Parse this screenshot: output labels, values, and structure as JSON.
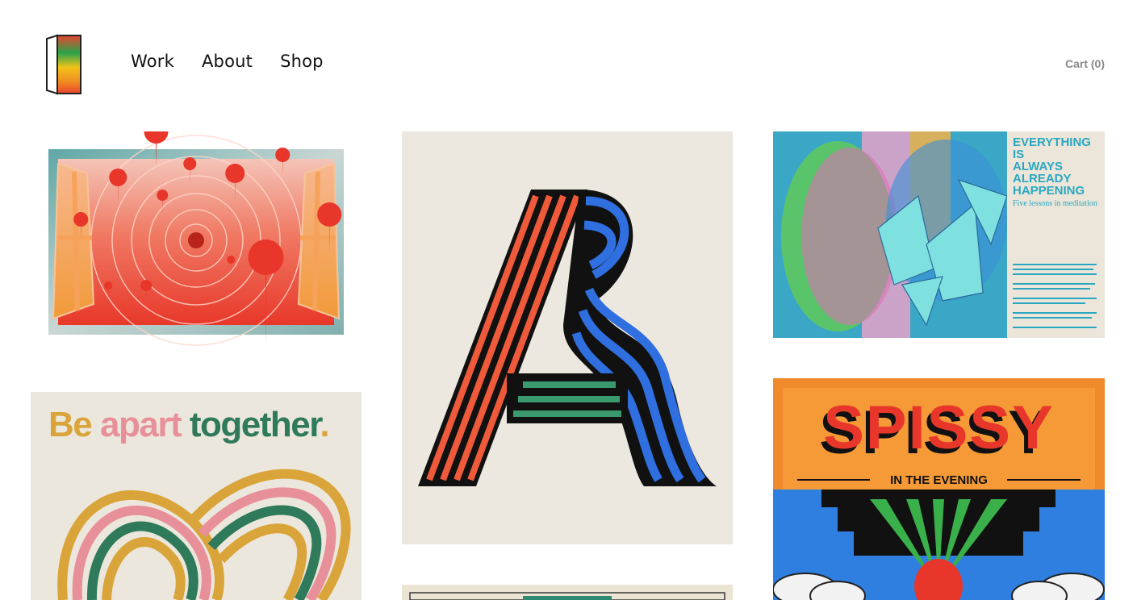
{
  "site": {
    "logo_name": "door-logo"
  },
  "nav": {
    "items": [
      {
        "label": "Work"
      },
      {
        "label": "About"
      },
      {
        "label": "Shop"
      }
    ]
  },
  "cart": {
    "label": "Cart (0)"
  },
  "gallery": {
    "meditation_poster": {
      "title_lines": [
        "EVERYTHING",
        "IS",
        "ALWAYS",
        "ALREADY",
        "HAPPENING"
      ],
      "subtitle": "Five lessons in meditation"
    },
    "apart_poster": {
      "words": [
        "Be",
        "a",
        "part",
        "together",
        "."
      ]
    },
    "spissy_poster": {
      "title": "SPISSY",
      "subtitle": "IN THE EVENING"
    }
  },
  "colors": {
    "text": "#111111",
    "cart": "#8a8a8a",
    "orange": "#ee5a3a",
    "blue": "#2f6fe0",
    "green": "#3a9a6e",
    "mustard": "#d9a53a",
    "pink": "#e8909a"
  }
}
